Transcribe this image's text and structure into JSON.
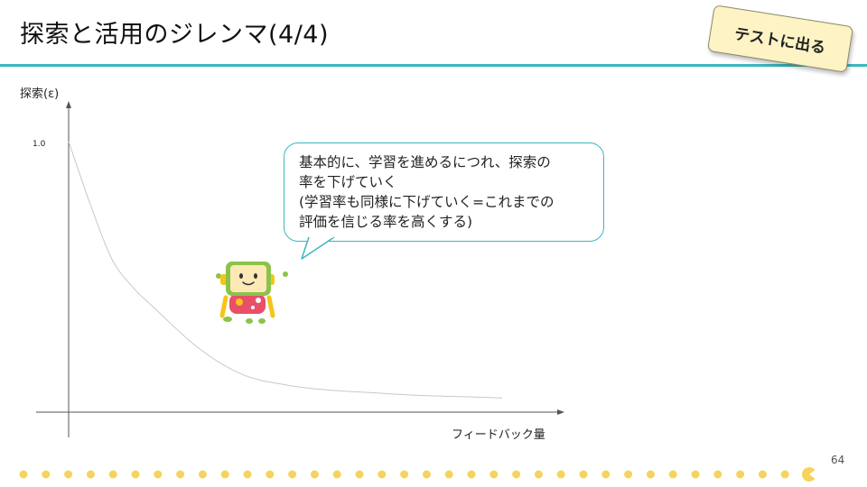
{
  "slide": {
    "title": "探索と活用のジレンマ(4/4)",
    "badge": "テストに出る",
    "page_number": "64"
  },
  "speech_bubble": {
    "lines": [
      "基本的に、学習を進めるにつれ、探索の",
      "率を下げていく",
      "(学習率も同様に下げていく=これまでの",
      "評価を信じる率を高くする)"
    ]
  },
  "chart_data": {
    "type": "line",
    "ylabel": "探索(ε)",
    "xlabel": "フィードバック量",
    "y_tick_labels": [
      "1.0"
    ],
    "ylim": [
      0,
      1.0
    ],
    "xlim": [
      0,
      1.0
    ],
    "grid": false,
    "series": [
      {
        "x": [
          0,
          0.05,
          0.1,
          0.15,
          0.2,
          0.3,
          0.4,
          0.5,
          0.6,
          0.7,
          0.8,
          0.9,
          1.0
        ],
        "y": [
          1.0,
          0.76,
          0.55,
          0.44,
          0.36,
          0.21,
          0.11,
          0.07,
          0.05,
          0.04,
          0.03,
          0.025,
          0.02
        ]
      }
    ],
    "colors": {
      "axis": "#555555",
      "curve": "#c8c8c8"
    }
  },
  "colors": {
    "accent": "#3ab8c0",
    "badge_bg": "#fdf3c4",
    "dot": "#f5d45a"
  },
  "icons": {
    "mascot": "robot-mascot-icon",
    "pacman": "pacman-icon"
  }
}
